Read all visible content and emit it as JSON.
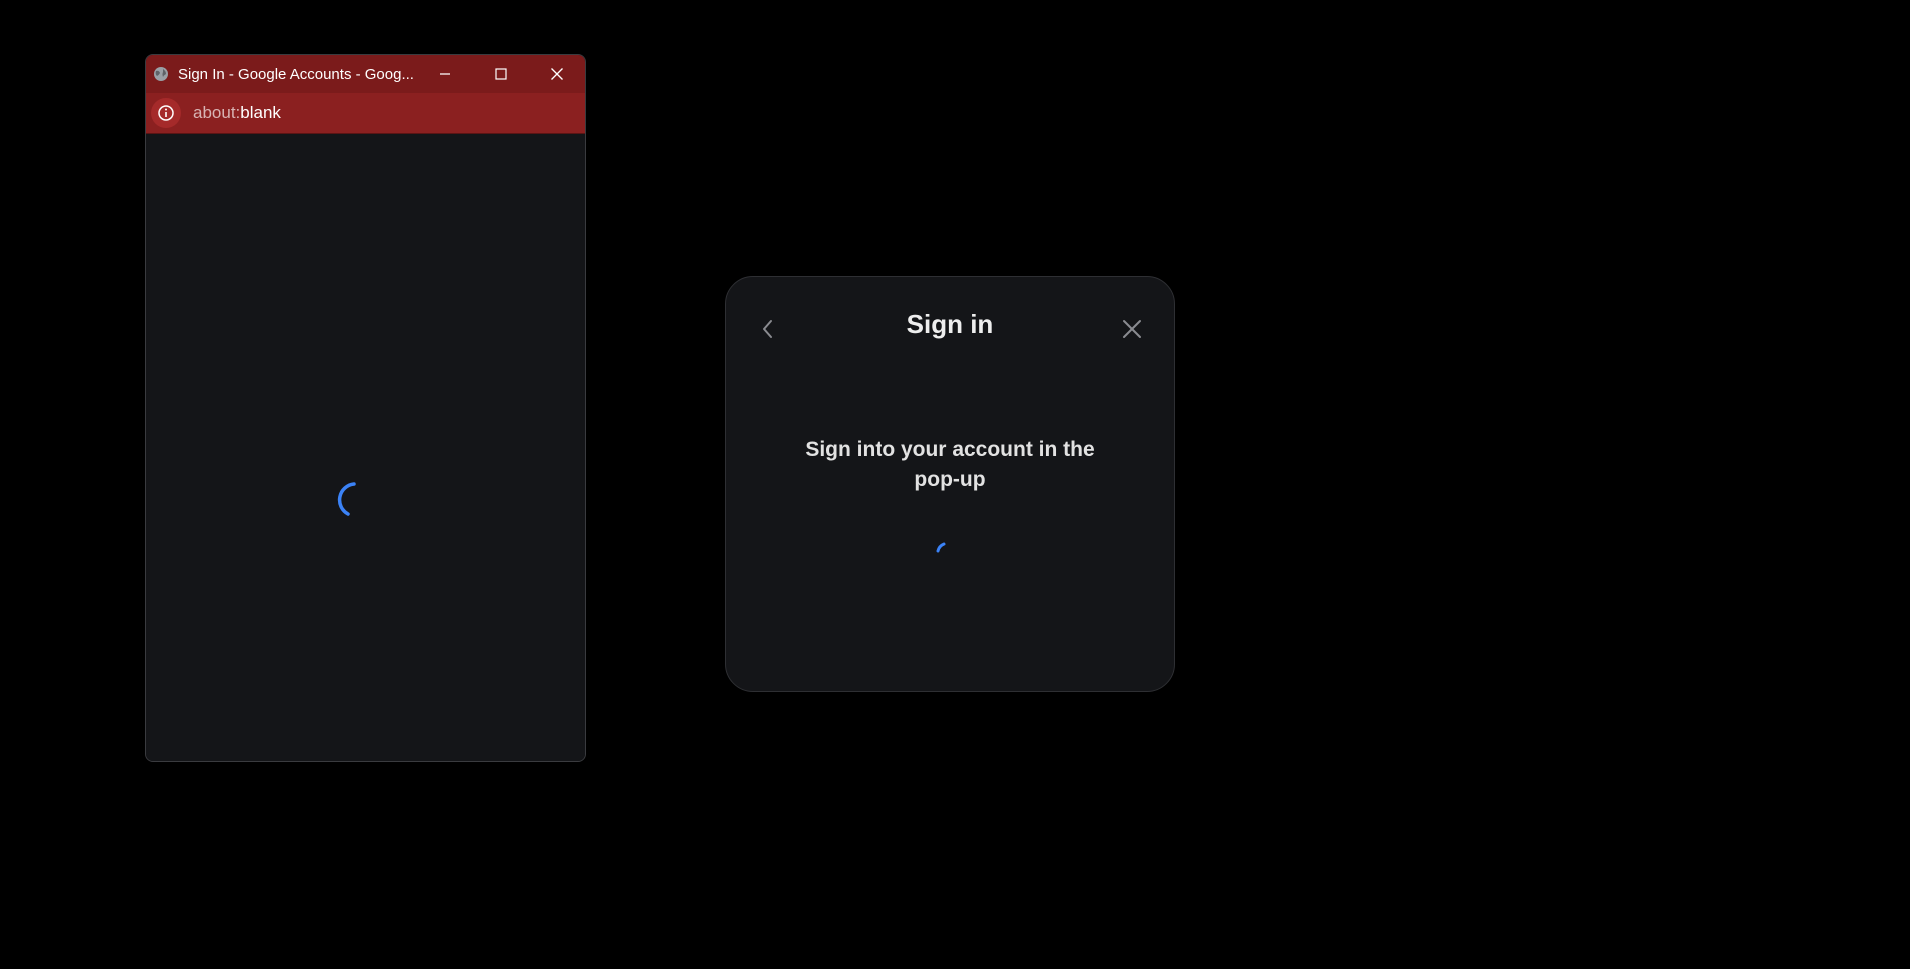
{
  "popup_window": {
    "title": "Sign In - Google Accounts - Goog...",
    "favicon": "globe-icon",
    "controls": {
      "minimize_icon": "minimize-icon",
      "maximize_icon": "maximize-icon",
      "close_icon": "close-icon"
    },
    "address_bar": {
      "info_icon": "info-icon",
      "url_scheme": "about:",
      "url_rest": "blank"
    },
    "content": {
      "spinner_icon": "loading-spinner-icon"
    },
    "colors": {
      "titlebar": "#7b1b1b",
      "addressbar": "#8b2020",
      "background": "#141518"
    }
  },
  "signin_modal": {
    "title": "Sign in",
    "back_icon": "chevron-left-icon",
    "close_icon": "close-icon",
    "message": "Sign into your account in the pop-up",
    "spinner_icon": "loading-spinner-icon",
    "colors": {
      "background": "#141518",
      "spinner": "#3b82f6"
    }
  }
}
